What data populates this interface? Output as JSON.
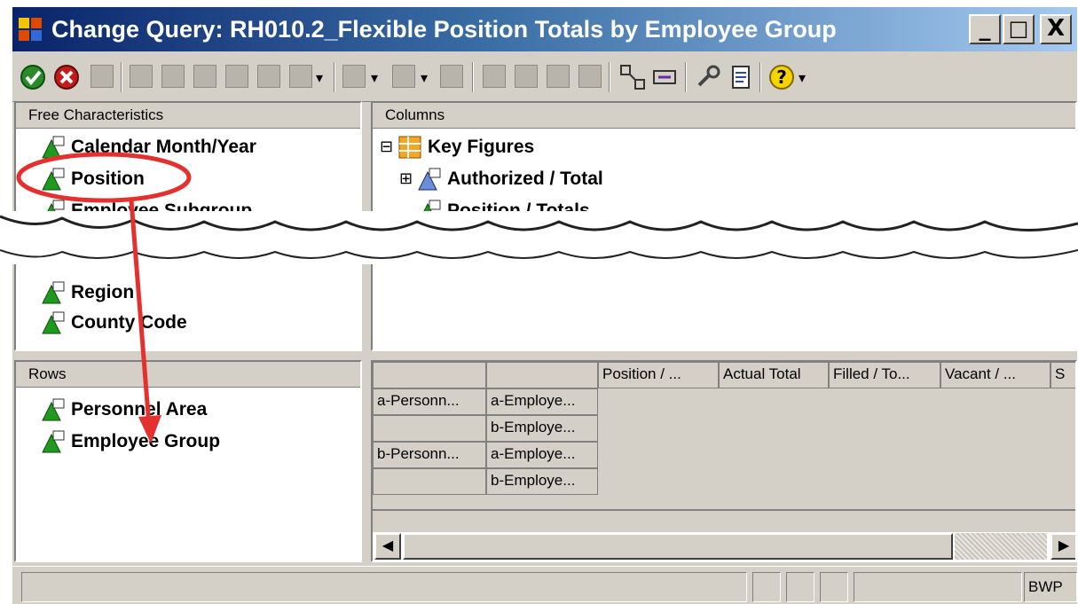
{
  "window": {
    "title": "Change Query: RH010.2_Flexible Position Totals by Employee Group",
    "controls": {
      "minimize": "_",
      "maximize": "□",
      "close": "X"
    }
  },
  "toolbar": {
    "icons": [
      "check-icon",
      "cancel-icon",
      "toolbar-icon-3",
      "toolbar-icon-4",
      "toolbar-icon-5",
      "toolbar-icon-6",
      "toolbar-icon-7",
      "toolbar-icon-8",
      "toolbar-icon-9",
      "toolbar-icon-10",
      "toolbar-icon-11",
      "toolbar-icon-12",
      "toolbar-icon-13",
      "toolbar-icon-14",
      "toolbar-icon-15",
      "toolbar-icon-16",
      "tools-icon",
      "document-icon",
      "help-icon"
    ],
    "dropdown_glyph": "▾"
  },
  "free_characteristics": {
    "header": "Free Characteristics",
    "items": [
      "Calendar Month/Year",
      "Position",
      "Employee Subgroup",
      "Region",
      "County Code"
    ]
  },
  "columns": {
    "header": "Columns",
    "root": "Key Figures",
    "items": [
      "Authorized / Total",
      "Position / Totals"
    ],
    "expand_glyphs": {
      "root": "⊟",
      "authorized": "⊞"
    }
  },
  "rows": {
    "header": "Rows",
    "items": [
      "Personnel Area",
      "Employee Group"
    ]
  },
  "preview": {
    "col_headers": [
      "",
      "",
      "Position / ...",
      "Actual Total",
      "Filled / To...",
      "Vacant / ...",
      "S"
    ],
    "row_cells": [
      [
        "a-Personn...",
        "a-Employe..."
      ],
      [
        "",
        "b-Employe..."
      ],
      [
        "b-Personn...",
        "a-Employe..."
      ],
      [
        "",
        "b-Employe..."
      ]
    ],
    "scroll_left": "◀",
    "scroll_right": "▶"
  },
  "status": {
    "segment": "BWP"
  },
  "colors": {
    "highlight": "#e53030",
    "title_start": "#0a246a",
    "title_end": "#a6caf0"
  }
}
